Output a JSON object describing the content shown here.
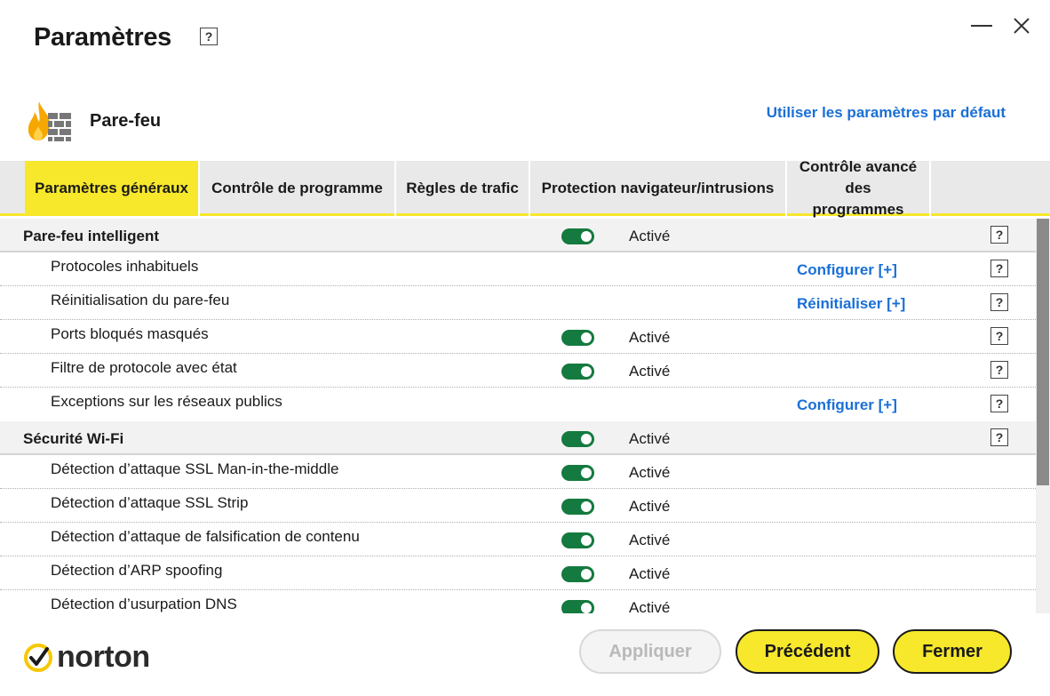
{
  "window": {
    "title": "Paramètres",
    "help": "?"
  },
  "section": {
    "title": "Pare-feu",
    "default_link": "Utiliser les paramètres par défaut"
  },
  "tabs": [
    {
      "label": "Paramètres généraux",
      "active": true
    },
    {
      "label": "Contrôle de programme",
      "active": false
    },
    {
      "label": "Règles de trafic",
      "active": false
    },
    {
      "label": "Protection navigateur/intrusions",
      "active": false
    },
    {
      "label": "Contrôle avancé des programmes",
      "active": false
    }
  ],
  "rows": [
    {
      "type": "group",
      "label": "Pare-feu intelligent",
      "toggle": true,
      "state": "Activé",
      "help": "?"
    },
    {
      "type": "item",
      "label": "Protocoles inhabituels",
      "action": "Configurer [+]",
      "help": "?"
    },
    {
      "type": "item",
      "label": "Réinitialisation du pare-feu",
      "action": "Réinitialiser [+]",
      "help": "?"
    },
    {
      "type": "item",
      "label": "Ports bloqués masqués",
      "toggle": true,
      "state": "Activé",
      "help": "?"
    },
    {
      "type": "item",
      "label": "Filtre de protocole avec état",
      "toggle": true,
      "state": "Activé",
      "help": "?"
    },
    {
      "type": "item",
      "label": "Exceptions sur les réseaux publics",
      "action": "Configurer [+]",
      "help": "?"
    },
    {
      "type": "group",
      "label": "Sécurité Wi-Fi",
      "toggle": true,
      "state": "Activé",
      "help": "?"
    },
    {
      "type": "item",
      "label": "Détection d’attaque SSL Man-in-the-middle",
      "toggle": true,
      "state": "Activé"
    },
    {
      "type": "item",
      "label": "Détection d’attaque SSL Strip",
      "toggle": true,
      "state": "Activé"
    },
    {
      "type": "item",
      "label": "Détection d’attaque de falsification de contenu",
      "toggle": true,
      "state": "Activé"
    },
    {
      "type": "item",
      "label": "Détection d’ARP spoofing",
      "toggle": true,
      "state": "Activé"
    },
    {
      "type": "item",
      "label": "Détection d’usurpation DNS",
      "toggle": true,
      "state": "Activé"
    }
  ],
  "footer": {
    "logo_text": "norton",
    "apply_label": "Appliquer",
    "previous_label": "Précédent",
    "close_label": "Fermer"
  },
  "colors": {
    "accent_yellow": "#f7e82b",
    "link_blue": "#1a6fd6",
    "toggle_green": "#147a3f"
  }
}
